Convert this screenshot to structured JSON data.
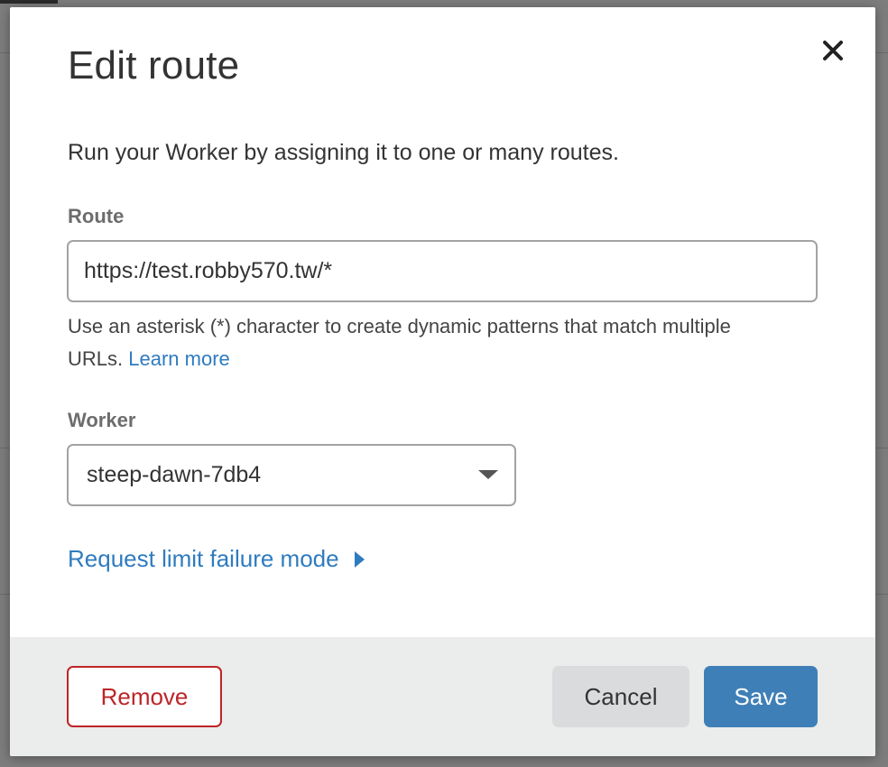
{
  "dialog": {
    "title": "Edit route",
    "close_icon": "close-icon",
    "intro": "Run your Worker by assigning it to one or many routes.",
    "route": {
      "label": "Route",
      "value": "https://test.robby570.tw/*"
    },
    "help": {
      "text": "Use an asterisk (*) character to create dynamic patterns that match multiple URLs.",
      "link": "Learn more"
    },
    "worker": {
      "label": "Worker",
      "selected": "steep-dawn-7db4",
      "dropdown_icon": "chevron-down-icon"
    },
    "failure_mode": {
      "label": "Request limit failure mode",
      "icon": "chevron-right-icon"
    },
    "footer": {
      "remove_label": "Remove",
      "cancel_label": "Cancel",
      "save_label": "Save"
    }
  },
  "colors": {
    "accent": "#3f7fb7",
    "link": "#2f7bbf",
    "danger": "#bd2527",
    "footer_bg": "#ebecec"
  }
}
